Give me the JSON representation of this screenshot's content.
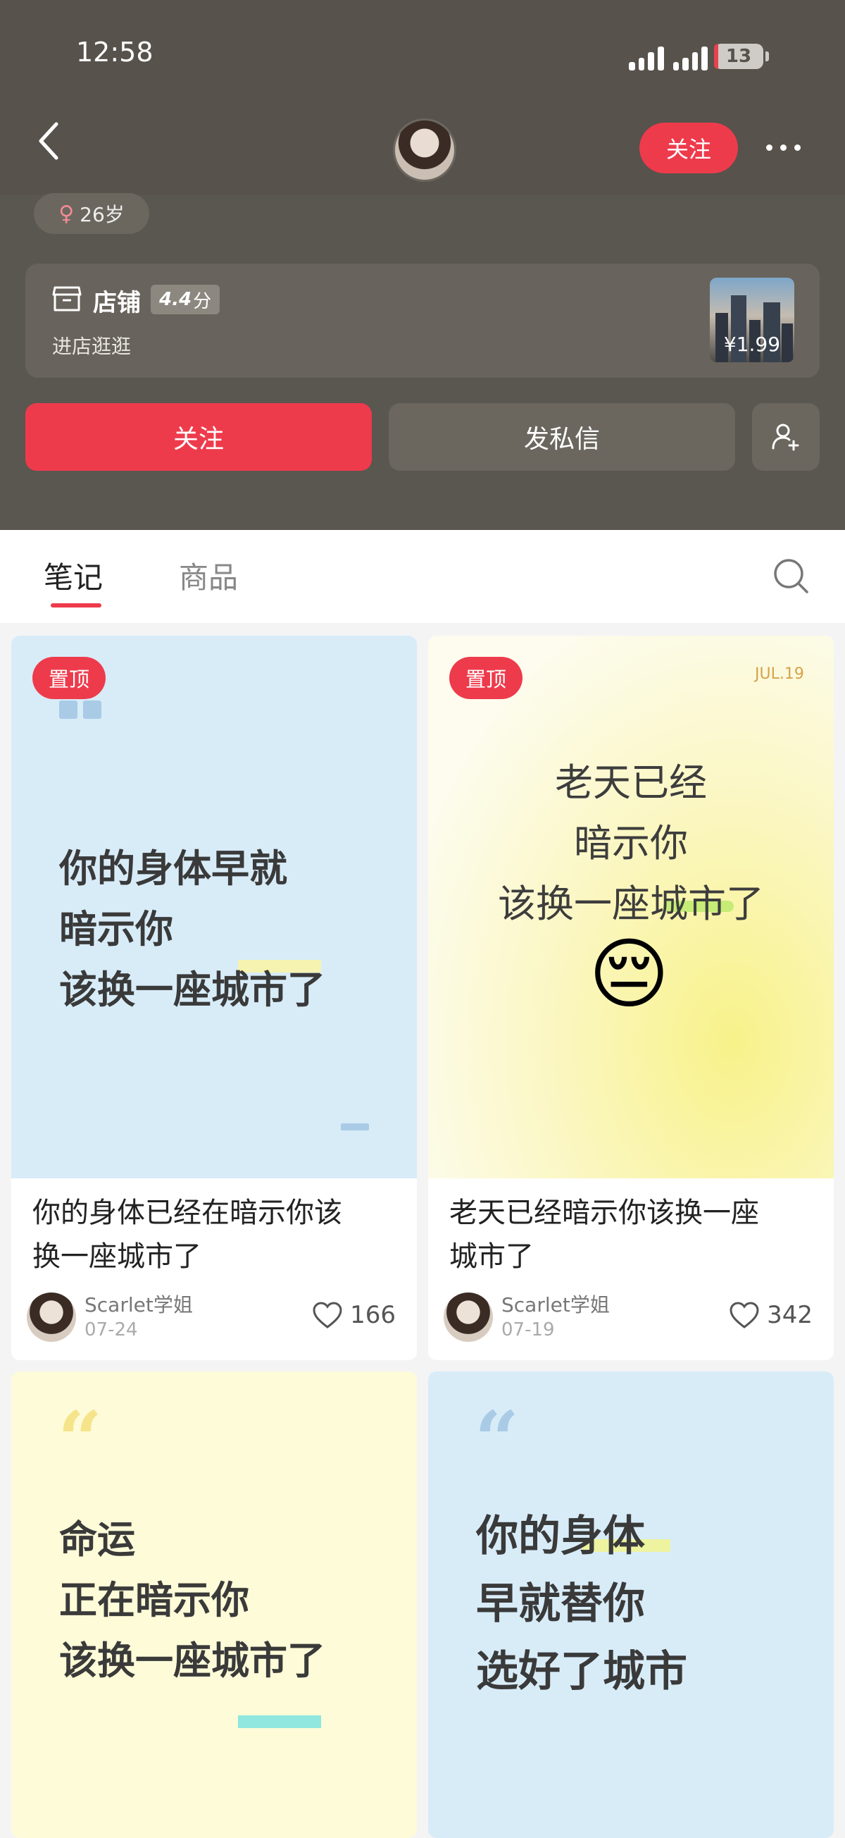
{
  "status_bar": {
    "time": "12:58",
    "battery": "13"
  },
  "nav": {
    "follow_label": "关注"
  },
  "profile": {
    "age": "26岁",
    "gender_symbol": "♀"
  },
  "shop": {
    "title": "店铺",
    "score": "4.4",
    "score_unit": "分",
    "subtitle": "进店逛逛",
    "price": "¥1.99"
  },
  "actions": {
    "follow_label": "关注",
    "message_label": "发私信"
  },
  "tabs": [
    {
      "label": "笔记",
      "active": true
    },
    {
      "label": "商品",
      "active": false
    }
  ],
  "notes": [
    {
      "pinned_label": "置顶",
      "cover_text": "你的身体早就\n暗示你\n该换一座城市了",
      "title": "你的身体已经在暗示你该\n换一座城市了",
      "author": "Scarlet学姐",
      "date": "07-24",
      "likes": "166",
      "cover_color": "#d8ecf8"
    },
    {
      "pinned_label": "置顶",
      "cover_badge": "JUL.19",
      "cover_text": "老天已经\n暗示你\n该换一座城市了",
      "cover_emoji": "😔",
      "title": "老天已经暗示你该换一座\n城市了",
      "author": "Scarlet学姐",
      "date": "07-19",
      "likes": "342",
      "cover_color": "#fbf7d0"
    },
    {
      "cover_text": "命运\n正在暗示你\n该换一座城市了",
      "cover_color": "#fdfbd8"
    },
    {
      "cover_text": "你的身体\n早就替你\n选好了城市",
      "cover_color": "#d8ecf8"
    }
  ],
  "colors": {
    "accent": "#ee3b4c",
    "header_bg": "#5a5650"
  }
}
